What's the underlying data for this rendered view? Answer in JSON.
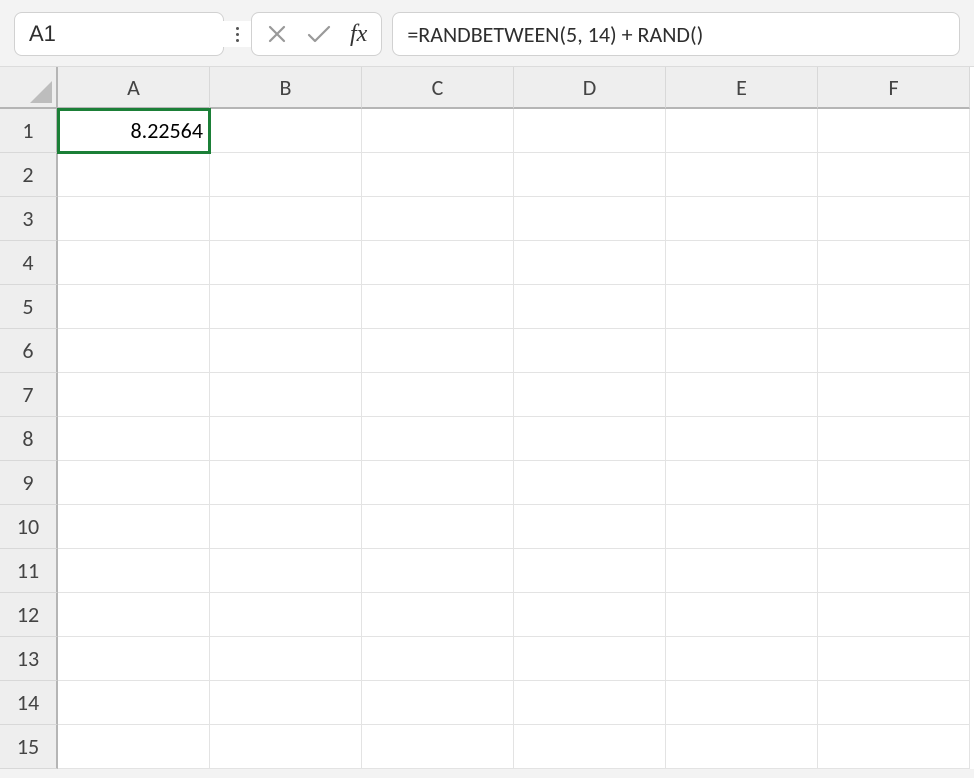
{
  "name_box": {
    "value": "A1"
  },
  "formula_bar": {
    "value": "=RANDBETWEEN(5, 14) + RAND()"
  },
  "columns": [
    "A",
    "B",
    "C",
    "D",
    "E",
    "F"
  ],
  "rows": [
    "1",
    "2",
    "3",
    "4",
    "5",
    "6",
    "7",
    "8",
    "9",
    "10",
    "11",
    "12",
    "13",
    "14",
    "15"
  ],
  "cells": {
    "A1": "8.22564"
  },
  "selected_cell": "A1"
}
